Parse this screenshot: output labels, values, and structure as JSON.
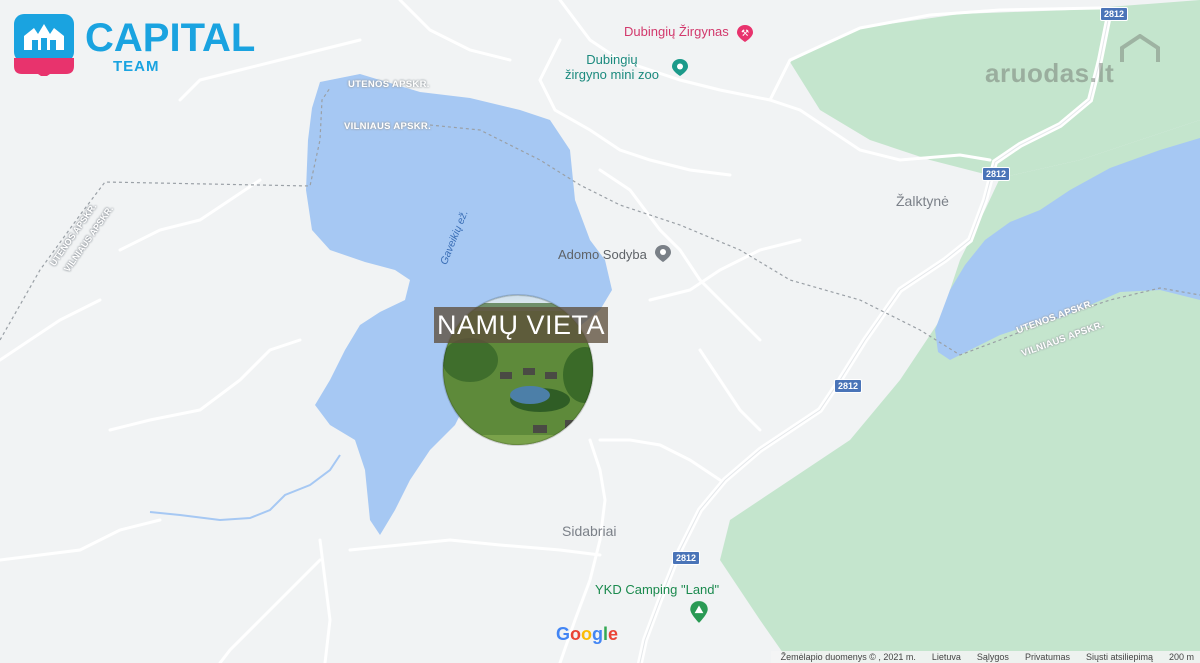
{
  "logo": {
    "brand": "CAPITAL",
    "sub": "TEAM"
  },
  "watermark": "aruodas.lt",
  "overlay": {
    "title": "NAMŲ VIETA"
  },
  "pois": {
    "zirgynas": "Dubingių Žirgynas",
    "minizoo_line1": "Dubingių",
    "minizoo_line2": "žirgyno mini zoo",
    "adomo": "Adomo Sodyba",
    "camping": "YKD Camping \"Land\""
  },
  "places": {
    "zalktyne": "Žalktynė",
    "sidabriai": "Sidabriai"
  },
  "water": {
    "lake_name": "Gaveikių ež."
  },
  "admin": {
    "utenos": "UTENOS APSKR.",
    "vilniaus": "VILNIAUS APSKR."
  },
  "road_shield": "2812",
  "google": [
    "G",
    "o",
    "o",
    "g",
    "l",
    "e"
  ],
  "attribution": {
    "data": "Žemėlapio duomenys © , 2021 m.",
    "country": "Lietuva",
    "terms": "Sąlygos",
    "privacy": "Privatumas",
    "report": "Siųsti atsiliepimą",
    "scale": "200 m"
  },
  "colors": {
    "water": "#a6c8f3",
    "forest": "#c4e5cd",
    "land": "#f1f3f4",
    "road": "#ffffff",
    "brand": "#1aa3e0",
    "pink": "#e8336d"
  }
}
